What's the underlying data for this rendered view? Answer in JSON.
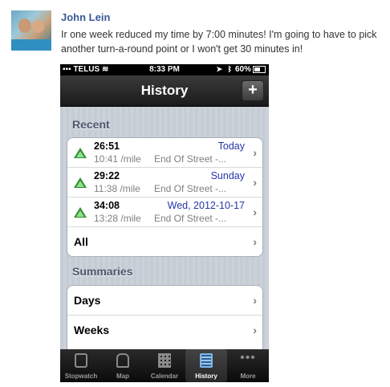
{
  "post": {
    "author": "John Lein",
    "text": "Ir one week reduced my time by 7:00 minutes! I'm going to have to pick another turn-a-round point or I won't get 30 minutes in!"
  },
  "status_bar": {
    "carrier": "TELUS",
    "time": "8:33 PM",
    "battery": "60%"
  },
  "nav": {
    "title": "History",
    "add_label": "+"
  },
  "recent": {
    "header": "Recent",
    "items": [
      {
        "duration": "26:51",
        "pace": "10:41 /mile",
        "date": "Today",
        "place": "End Of Street -..."
      },
      {
        "duration": "29:22",
        "pace": "11:38 /mile",
        "date": "Sunday",
        "place": "End Of Street -..."
      },
      {
        "duration": "34:08",
        "pace": "13:28 /mile",
        "date": "Wed, 2012-10-17",
        "place": "End Of Street -..."
      }
    ],
    "all_label": "All"
  },
  "summaries": {
    "header": "Summaries",
    "items": [
      {
        "label": "Days"
      },
      {
        "label": "Weeks"
      }
    ]
  },
  "tabs": [
    {
      "label": "Stopwatch",
      "icon": "stopwatch-icon"
    },
    {
      "label": "Map",
      "icon": "map-icon"
    },
    {
      "label": "Calendar",
      "icon": "calendar-icon"
    },
    {
      "label": "History",
      "icon": "history-icon",
      "active": true
    },
    {
      "label": "More",
      "icon": "more-icon"
    }
  ],
  "colors": {
    "author_link": "#3b5998",
    "date_text": "#2536a8",
    "trend_up": "#2f8f2f"
  }
}
